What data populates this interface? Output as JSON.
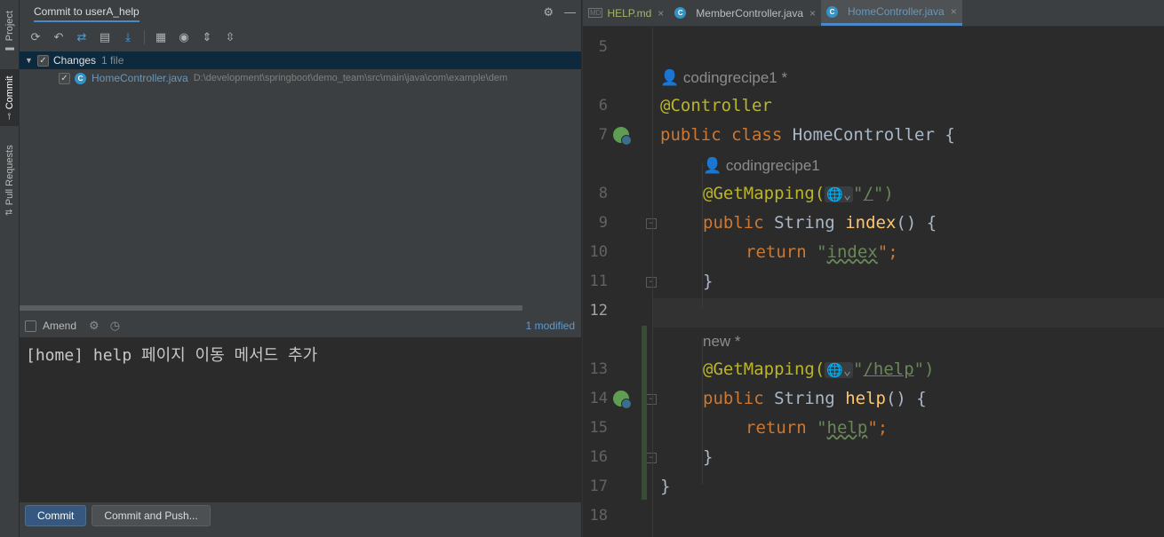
{
  "tool_strip": {
    "project": "Project",
    "commit": "Commit",
    "pull_requests": "Pull Requests"
  },
  "commit_panel": {
    "title": "Commit to userA_help",
    "changes_group": {
      "label": "Changes",
      "count": "1 file"
    },
    "file": {
      "name": "HomeController.java",
      "path": "D:\\development\\springboot\\demo_team\\src\\main\\java\\com\\example\\dem"
    },
    "amend_label": "Amend",
    "modified_text": "1 modified",
    "message": "[home] help 페이지 이동 메서드 추가",
    "commit_button": "Commit",
    "commit_push_button": "Commit and Push..."
  },
  "editor": {
    "tabs": [
      {
        "label": "HELP.md",
        "active": false
      },
      {
        "label": "MemberController.java",
        "active": false
      },
      {
        "label": "HomeController.java",
        "active": true
      }
    ],
    "line_numbers": [
      "5",
      "6",
      "7",
      "8",
      "9",
      "10",
      "11",
      "12",
      "13",
      "14",
      "15",
      "16",
      "17",
      "18"
    ],
    "current_line": "12",
    "hints": {
      "author_class": "codingrecipe1 *",
      "author_method": "codingrecipe1",
      "new_method": "new *"
    },
    "code": {
      "controller_annotation": "@Controller",
      "kw_public": "public",
      "kw_class": "class",
      "class_name": "HomeController {",
      "get_mapping": "@GetMapping(",
      "open_quote": "\"",
      "path_root": "/",
      "close_paren": "\")",
      "path_help": "/help",
      "type_string": "String",
      "method_index": "index",
      "method_help": "help",
      "method_tail": "() {",
      "kw_return": "return",
      "str_index": "index",
      "str_help": "help",
      "semi": "\";",
      "close_brace": "}",
      "globe_glyph": "🌐⌄"
    }
  },
  "colors": {
    "accent": "#4a88c7",
    "keyword": "#cc7832",
    "annotation": "#bbb529",
    "string": "#6a8759",
    "method": "#ffc66d"
  }
}
